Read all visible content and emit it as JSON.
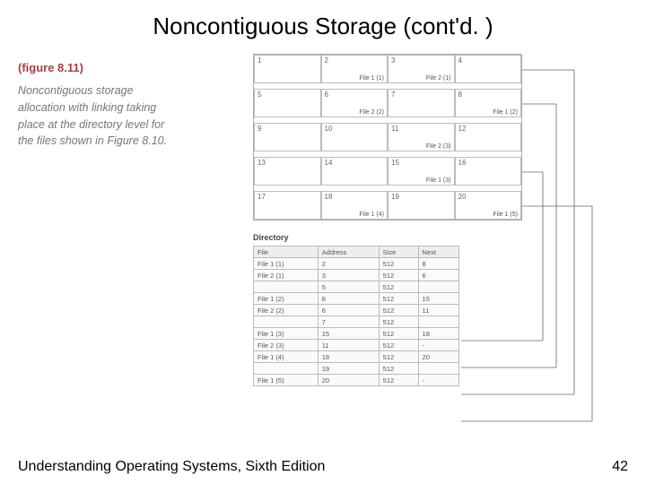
{
  "title": "Noncontiguous Storage (cont'd. )",
  "figure_label": "(figure 8.11)",
  "caption": "Noncontiguous storage allocation with linking taking place at the directory level for the files shown in Figure 8.10.",
  "grid": {
    "rows": [
      [
        {
          "n": "1"
        },
        {
          "n": "2",
          "l": "File 1 (1)"
        },
        {
          "n": "3",
          "l": "File 2 (1)"
        },
        {
          "n": "4"
        }
      ],
      [
        {
          "n": "5"
        },
        {
          "n": "6",
          "l": "File 2 (2)"
        },
        {
          "n": "7"
        },
        {
          "n": "8",
          "l": "File 1 (2)"
        }
      ],
      [
        {
          "n": "9"
        },
        {
          "n": "10"
        },
        {
          "n": "11",
          "l": "File 2 (3)"
        },
        {
          "n": "12"
        }
      ],
      [
        {
          "n": "13"
        },
        {
          "n": "14"
        },
        {
          "n": "15",
          "l": "File 1 (3)"
        },
        {
          "n": "16"
        }
      ],
      [
        {
          "n": "17"
        },
        {
          "n": "18",
          "l": "File 1 (4)"
        },
        {
          "n": "19"
        },
        {
          "n": "20",
          "l": "File 1 (5)"
        }
      ]
    ]
  },
  "dir_heading": "Directory",
  "dir_columns": [
    "File",
    "Address",
    "Size",
    "Next"
  ],
  "dir_rows": [
    [
      "File 1 (1)",
      "2",
      "512",
      "8"
    ],
    [
      "File 2 (1)",
      "3",
      "512",
      "6"
    ],
    [
      "",
      "5",
      "512",
      ""
    ],
    [
      "File 1 (2)",
      "8",
      "512",
      "15"
    ],
    [
      "File 2 (2)",
      "6",
      "512",
      "11"
    ],
    [
      "",
      "7",
      "512",
      ""
    ],
    [
      "File 1 (3)",
      "15",
      "512",
      "18"
    ],
    [
      "File 2 (3)",
      "11",
      "512",
      "-"
    ],
    [
      "File 1 (4)",
      "18",
      "512",
      "20"
    ],
    [
      "",
      "19",
      "512",
      ""
    ],
    [
      "File 1 (5)",
      "20",
      "512",
      "-"
    ]
  ],
  "footer_left": "Understanding Operating Systems, Sixth Edition",
  "footer_right": "42"
}
